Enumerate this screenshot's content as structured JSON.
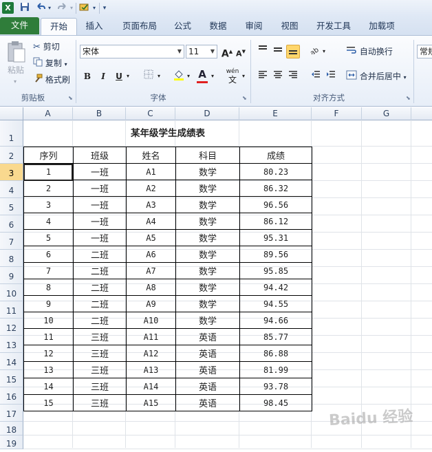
{
  "app": {
    "logo_letter": "X"
  },
  "qat": {
    "save_icon": "save-icon",
    "undo_icon": "undo-icon",
    "redo_icon": "redo-icon"
  },
  "tabs": [
    {
      "label": "文件"
    },
    {
      "label": "开始"
    },
    {
      "label": "插入"
    },
    {
      "label": "页面布局"
    },
    {
      "label": "公式"
    },
    {
      "label": "数据"
    },
    {
      "label": "审阅"
    },
    {
      "label": "视图"
    },
    {
      "label": "开发工具"
    },
    {
      "label": "加载项"
    }
  ],
  "ribbon": {
    "clipboard": {
      "label": "剪贴板",
      "paste": "粘贴",
      "cut": "剪切",
      "copy": "复制",
      "format_painter": "格式刷"
    },
    "font": {
      "label": "字体",
      "font_name": "宋体",
      "font_size": "11",
      "grow": "A",
      "shrink": "A",
      "bold": "B",
      "italic": "I",
      "underline": "U",
      "font_color_letter": "A",
      "phonetic": "wén"
    },
    "alignment": {
      "label": "对齐方式",
      "wrap_text": "自动换行",
      "merge_center": "合并后居中"
    },
    "number": {
      "format": "常规"
    }
  },
  "sheet": {
    "columns": [
      "A",
      "B",
      "C",
      "D",
      "E",
      "F",
      "G"
    ],
    "rows": [
      "1",
      "2",
      "3",
      "4",
      "5",
      "6",
      "7",
      "8",
      "9",
      "10",
      "11",
      "12",
      "13",
      "14",
      "15",
      "16",
      "17",
      "18",
      "19"
    ],
    "title": "某年级学生成绩表",
    "headers": [
      "序列",
      "班级",
      "姓名",
      "科目",
      "成绩"
    ],
    "data": [
      [
        "1",
        "一班",
        "A1",
        "数学",
        "80.23"
      ],
      [
        "2",
        "一班",
        "A2",
        "数学",
        "86.32"
      ],
      [
        "3",
        "一班",
        "A3",
        "数学",
        "96.56"
      ],
      [
        "4",
        "一班",
        "A4",
        "数学",
        "86.12"
      ],
      [
        "5",
        "一班",
        "A5",
        "数学",
        "95.31"
      ],
      [
        "6",
        "二班",
        "A6",
        "数学",
        "89.56"
      ],
      [
        "7",
        "二班",
        "A7",
        "数学",
        "95.85"
      ],
      [
        "8",
        "二班",
        "A8",
        "数学",
        "94.42"
      ],
      [
        "9",
        "二班",
        "A9",
        "数学",
        "94.55"
      ],
      [
        "10",
        "二班",
        "A10",
        "数学",
        "94.66"
      ],
      [
        "11",
        "三班",
        "A11",
        "英语",
        "85.77"
      ],
      [
        "12",
        "三班",
        "A12",
        "英语",
        "86.88"
      ],
      [
        "13",
        "三班",
        "A13",
        "英语",
        "81.99"
      ],
      [
        "14",
        "三班",
        "A14",
        "英语",
        "93.78"
      ],
      [
        "15",
        "三班",
        "A15",
        "英语",
        "98.45"
      ]
    ]
  },
  "watermark": "Baidu 经验",
  "colors": {
    "file_tab": "#2f7d3a",
    "selection": "#f9d98f",
    "align_active": "#ffd66b"
  }
}
